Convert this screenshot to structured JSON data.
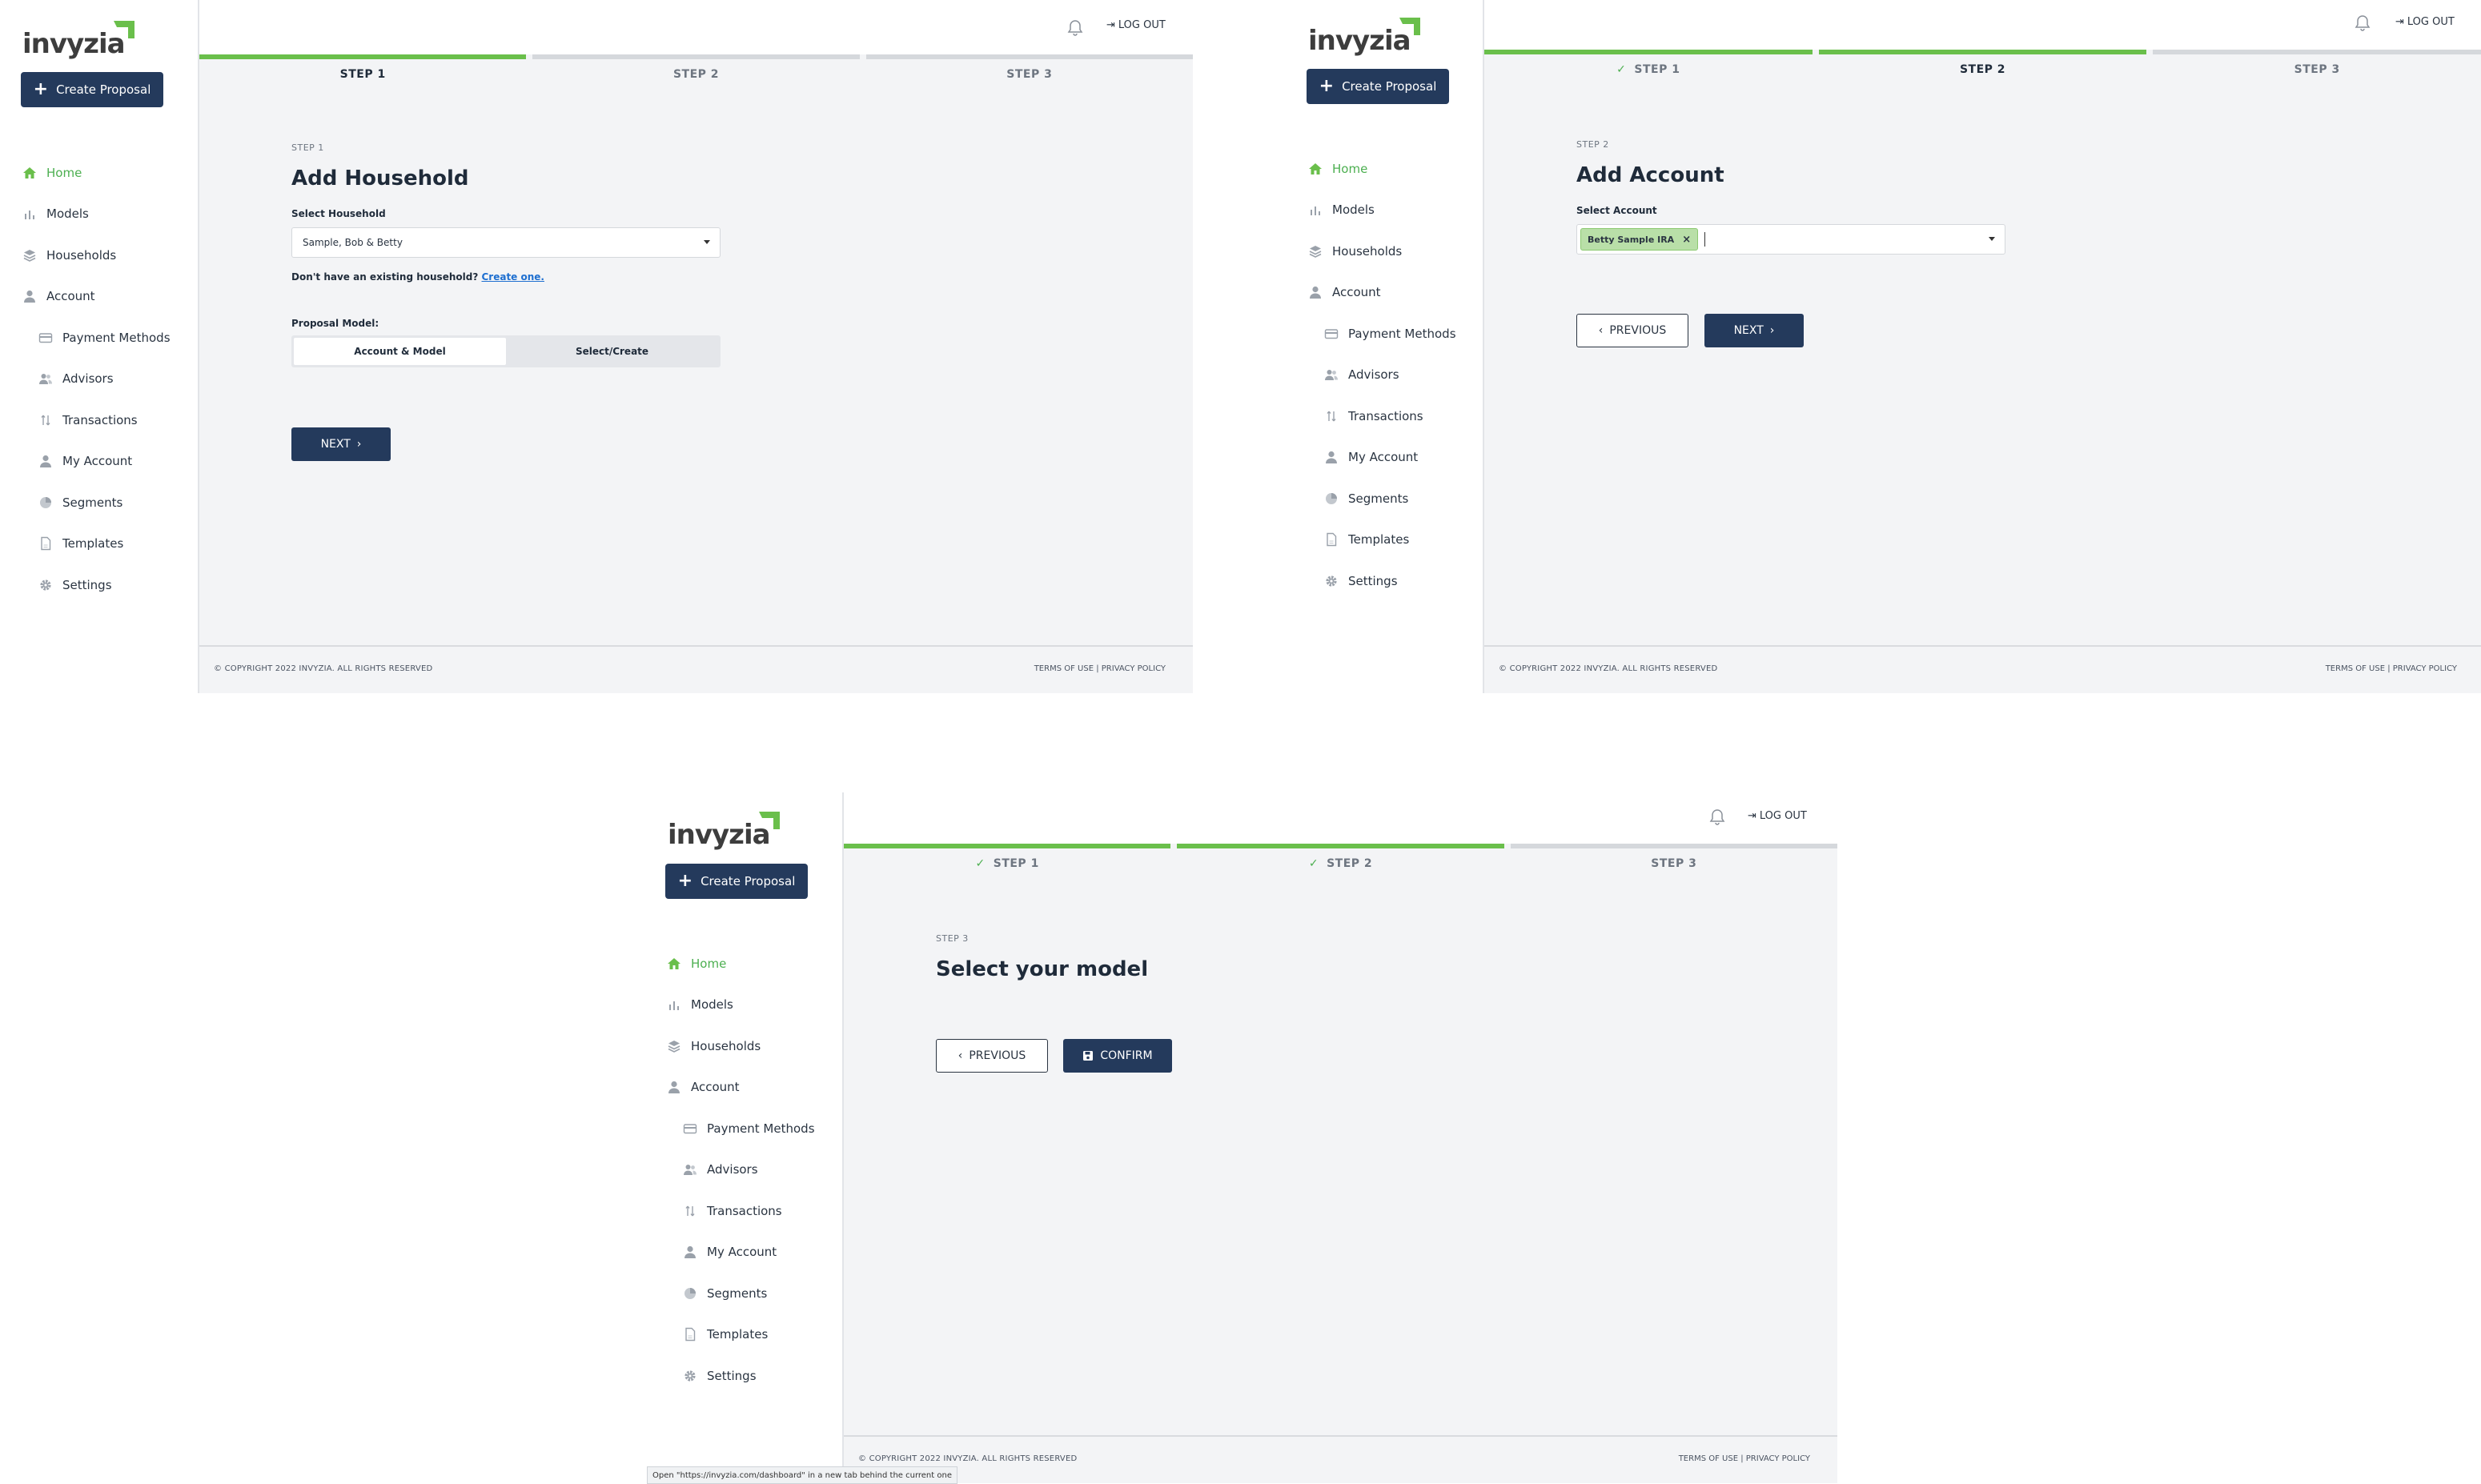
{
  "brand": {
    "logo_text": "invyzia",
    "accent": "#6abf4b",
    "navy": "#243a5c"
  },
  "sidebar": {
    "create_label": "Create Proposal",
    "items": [
      {
        "label": "Home",
        "icon": "home-icon"
      },
      {
        "label": "Models",
        "icon": "bar-chart-icon"
      },
      {
        "label": "Households",
        "icon": "layers-icon"
      },
      {
        "label": "Account",
        "icon": "user-icon"
      },
      {
        "label": "Payment Methods",
        "icon": "credit-card-icon"
      },
      {
        "label": "Advisors",
        "icon": "users-icon"
      },
      {
        "label": "Transactions",
        "icon": "transfer-icon"
      },
      {
        "label": "My Account",
        "icon": "user-icon"
      },
      {
        "label": "Segments",
        "icon": "pie-chart-icon"
      },
      {
        "label": "Templates",
        "icon": "document-icon"
      },
      {
        "label": "Settings",
        "icon": "gear-icon"
      }
    ]
  },
  "topbar": {
    "logout_label": "LOG OUT"
  },
  "steps": [
    "STEP 1",
    "STEP 2",
    "STEP 3"
  ],
  "screen1": {
    "eyebrow": "STEP 1",
    "title": "Add Household",
    "select_label": "Select Household",
    "select_value": "Sample, Bob & Betty",
    "helper_text": "Don't have an existing household?",
    "helper_link": "Create one.",
    "model_label": "Proposal Model:",
    "model_options": [
      "Account & Model",
      "Select/Create"
    ],
    "next_label": "NEXT"
  },
  "screen2": {
    "eyebrow": "STEP 2",
    "title": "Add Account",
    "select_label": "Select Account",
    "chip": "Betty Sample IRA",
    "previous_label": "PREVIOUS",
    "next_label": "NEXT"
  },
  "screen3": {
    "eyebrow": "STEP 3",
    "title": "Select your model",
    "previous_label": "PREVIOUS",
    "confirm_label": "CONFIRM"
  },
  "footer": {
    "copyright": "© COPYRIGHT 2022 INVYZIA. ALL RIGHTS RESERVED",
    "terms": "TERMS OF USE",
    "privacy": "PRIVACY POLICY"
  },
  "status_bar": "Open \"https://invyzia.com/dashboard\" in a new tab behind the current one"
}
